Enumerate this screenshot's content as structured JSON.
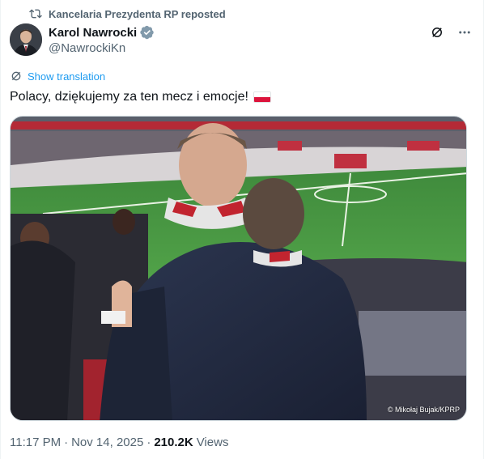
{
  "repost": {
    "label": "Kancelaria Prezydenta RP reposted",
    "icon": "repost-icon"
  },
  "author": {
    "name": "Karol Nawrocki",
    "handle": "@NawrockiKn",
    "verified": true,
    "verified_color": "#829aab"
  },
  "actions": {
    "grok_icon": "grok-icon",
    "more_icon": "more-icon"
  },
  "translation": {
    "label": "Show translation",
    "icon": "globe-icon"
  },
  "tweet": {
    "text": "Polacy, dziękujemy za ten mecz i emocje!",
    "flag": "Poland flag"
  },
  "media": {
    "credit": "© Mikołaj Bujak/KPRP"
  },
  "meta": {
    "time": "11:17 PM",
    "sep1": "·",
    "date": "Nov 14, 2025",
    "sep2": "·",
    "views_count": "210.2K",
    "views_label": "Views"
  },
  "colors": {
    "text": "#0f1419",
    "secondary": "#536471",
    "link": "#1d9bf0",
    "border": "#cfd9de",
    "flag_red": "#dc143c"
  }
}
